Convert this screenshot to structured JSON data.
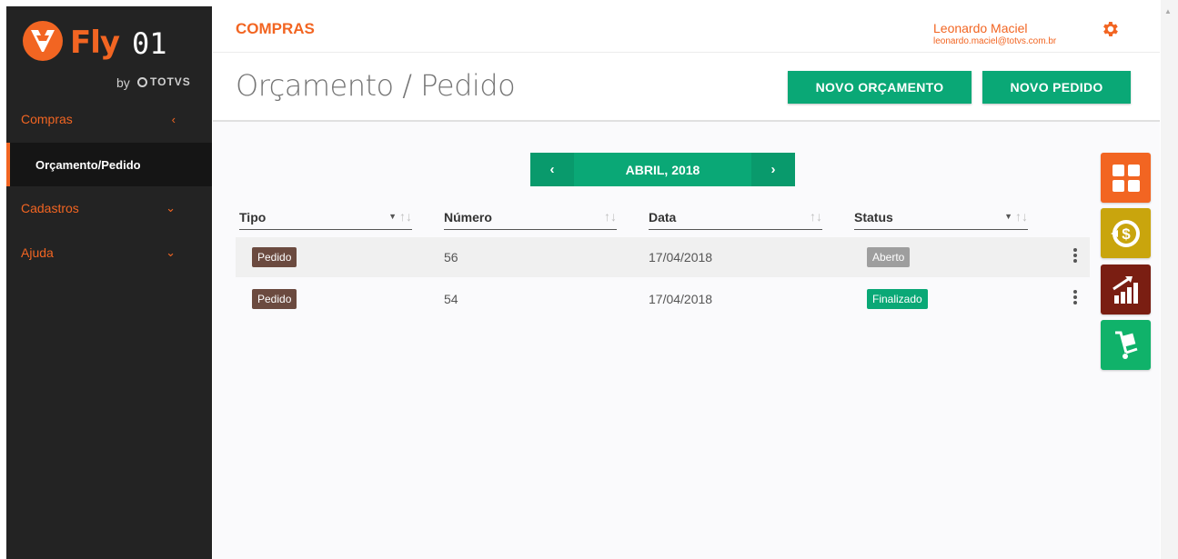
{
  "brand": {
    "fly": "Fly",
    "zero_one": "01",
    "by": "by",
    "totvs": "TOTVS",
    "accent_color": "#f26522",
    "green_color": "#0aa876"
  },
  "sidebar": {
    "items": [
      {
        "label": "Compras",
        "chevron": "‹",
        "icon": "chevron-left-icon"
      },
      {
        "label": "Cadastros",
        "chevron": "⌄",
        "icon": "chevron-down-icon"
      },
      {
        "label": "Ajuda",
        "chevron": "⌄",
        "icon": "chevron-down-icon"
      }
    ],
    "active_sub": "Orçamento/Pedido"
  },
  "header": {
    "module": "COMPRAS",
    "user_name": "Leonardo Maciel",
    "user_email": "leonardo.maciel@totvs.com.br",
    "settings_icon": "gear-icon"
  },
  "page": {
    "title": "Orçamento / Pedido",
    "buttons": {
      "new_budget": "NOVO ORÇAMENTO",
      "new_order": "NOVO PEDIDO"
    }
  },
  "month_nav": {
    "prev": "‹",
    "label": "ABRIL, 2018",
    "next": "›"
  },
  "table": {
    "columns": {
      "tipo": "Tipo",
      "numero": "Número",
      "data": "Data",
      "status": "Status"
    },
    "sort_glyph": "↑↓",
    "filter_glyph": "▼",
    "rows": [
      {
        "tipo": "Pedido",
        "numero": "56",
        "data": "17/04/2018",
        "status": "Aberto",
        "status_color": "#9e9e9e"
      },
      {
        "tipo": "Pedido",
        "numero": "54",
        "data": "17/04/2018",
        "status": "Finalizado",
        "status_color": "#0aa876"
      }
    ]
  },
  "apps": [
    {
      "icon": "apps-grid-icon",
      "color": "#f26522"
    },
    {
      "icon": "finance-coin-icon",
      "color": "#c9a50d"
    },
    {
      "icon": "growth-chart-icon",
      "color": "#7a1e12"
    },
    {
      "icon": "hand-truck-icon",
      "color": "#10b26a"
    }
  ]
}
